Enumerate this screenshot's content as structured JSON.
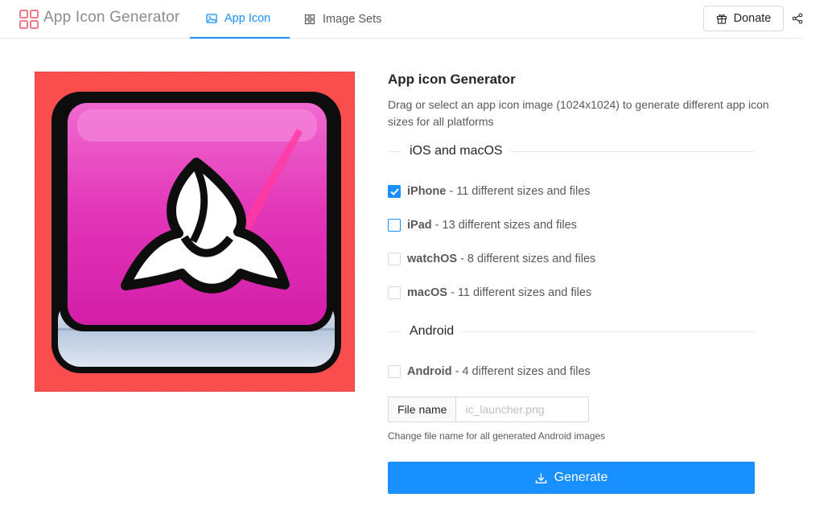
{
  "header": {
    "app_title": "App Icon Generator",
    "tabs": [
      {
        "label": "App Icon",
        "icon": "picture-icon",
        "active": true
      },
      {
        "label": "Image Sets",
        "icon": "grid-icon",
        "active": false
      }
    ],
    "donate_label": "Donate",
    "accent_color": "#1890ff"
  },
  "panel": {
    "title": "App icon Generator",
    "description": "Drag or select an app icon image (1024x1024) to generate different app icon sizes for all platforms",
    "sections": [
      {
        "heading": "iOS and macOS",
        "options": [
          {
            "name": "iPhone",
            "detail": " - 11 different sizes and files",
            "checked": true
          },
          {
            "name": "iPad",
            "detail": " - 13 different sizes and files",
            "checked": false
          },
          {
            "name": "watchOS",
            "detail": " - 8 different sizes and files",
            "checked": false
          },
          {
            "name": "macOS",
            "detail": " - 11 different sizes and files",
            "checked": false
          }
        ]
      },
      {
        "heading": "Android",
        "options": [
          {
            "name": "Android",
            "detail": " - 4 different sizes and files",
            "checked": false
          }
        ]
      }
    ],
    "file_name": {
      "label": "File name",
      "placeholder": "ic_launcher.png",
      "value": "",
      "help": "Change file name for all generated Android images"
    },
    "generate_label": "Generate"
  }
}
